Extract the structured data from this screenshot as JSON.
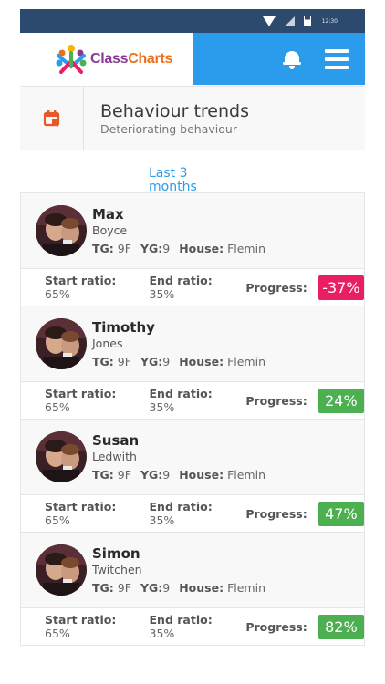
{
  "statusbar": {
    "time": "12:30"
  },
  "app": {
    "brand_part1": "Class",
    "brand_part2": "Charts"
  },
  "colors": {
    "positive": "#4caf50",
    "negative": "#e91e63",
    "accent": "#2b9cec"
  },
  "page": {
    "title": "Behaviour trends",
    "subtitle": "Deteriorating behaviour"
  },
  "filter": {
    "period_line1": "Last 3",
    "period_line2": "months"
  },
  "labels": {
    "tg": "TG:",
    "yg": "YG:",
    "house": "House:",
    "start_ratio": "Start ratio:",
    "end_ratio": "End ratio:",
    "progress": "Progress:"
  },
  "students": [
    {
      "first_name": "Max",
      "last_name": "Boyce",
      "tg": "9F",
      "yg": "9",
      "house": "Flemin",
      "start_ratio": "65%",
      "end_ratio": "35%",
      "progress": "-37%",
      "progress_status": "negative"
    },
    {
      "first_name": "Timothy",
      "last_name": "Jones",
      "tg": "9F",
      "yg": "9",
      "house": "Flemin",
      "start_ratio": "65%",
      "end_ratio": "35%",
      "progress": "24%",
      "progress_status": "positive"
    },
    {
      "first_name": "Susan",
      "last_name": "Ledwith",
      "tg": "9F",
      "yg": "9",
      "house": "Flemin",
      "start_ratio": "65%",
      "end_ratio": "35%",
      "progress": "47%",
      "progress_status": "positive"
    },
    {
      "first_name": "Simon",
      "last_name": "Twitchen",
      "tg": "9F",
      "yg": "9",
      "house": "Flemin",
      "start_ratio": "65%",
      "end_ratio": "35%",
      "progress": "82%",
      "progress_status": "positive"
    }
  ]
}
